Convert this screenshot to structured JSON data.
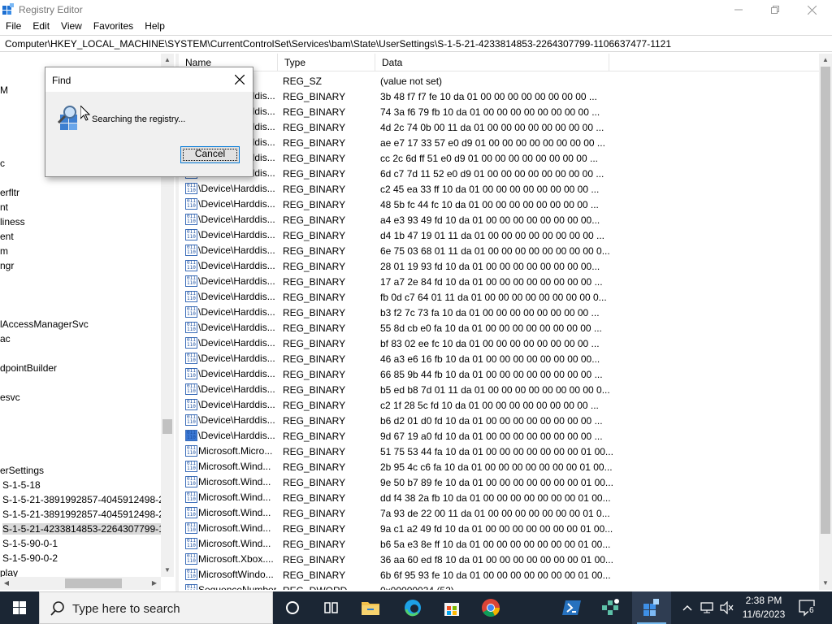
{
  "window": {
    "title": "Registry Editor",
    "menu": [
      "File",
      "Edit",
      "View",
      "Favorites",
      "Help"
    ],
    "address": "Computer\\HKEY_LOCAL_MACHINE\\SYSTEM\\CurrentControlSet\\Services\\bam\\State\\UserSettings\\S-1-5-21-4233814853-2264307799-1106637477-1121"
  },
  "tree": {
    "nodes": [
      {
        "label": "M",
        "selected": false
      },
      {
        "label": "c",
        "selected": false
      },
      {
        "label": "erfltr",
        "selected": false
      },
      {
        "label": "nt",
        "selected": false
      },
      {
        "label": "liness",
        "selected": false
      },
      {
        "label": "ent",
        "selected": false
      },
      {
        "label": "m",
        "selected": false
      },
      {
        "label": "ngr",
        "selected": false
      },
      {
        "label": "lAccessManagerSvc",
        "selected": false
      },
      {
        "label": "ac",
        "selected": false
      },
      {
        "label": "dpointBuilder",
        "selected": false
      },
      {
        "label": "esvc",
        "selected": false
      },
      {
        "label": "erSettings",
        "selected": false
      },
      {
        "label": "S-1-5-18",
        "selected": false
      },
      {
        "label": "S-1-5-21-3891992857-4045912498-27",
        "selected": false
      },
      {
        "label": "S-1-5-21-3891992857-4045912498-27",
        "selected": false
      },
      {
        "label": "S-1-5-21-4233814853-2264307799-11",
        "selected": true
      },
      {
        "label": "S-1-5-90-0-1",
        "selected": false
      },
      {
        "label": "S-1-5-90-0-2",
        "selected": false
      },
      {
        "label": "play",
        "selected": false
      }
    ]
  },
  "list": {
    "columns": [
      "Name",
      "Type",
      "Data"
    ],
    "rows": [
      {
        "name": "",
        "type": "REG_SZ",
        "data": "(value not set)",
        "icon": "string",
        "selected": false
      },
      {
        "name": "\\Device\\Harddis...",
        "type": "REG_BINARY",
        "data": "3b 48 f7 f7 fe 10 da 01 00 00 00 00 00 00 00 00 ...",
        "icon": "binary",
        "selected": false
      },
      {
        "name": "\\Device\\Harddis...",
        "type": "REG_BINARY",
        "data": "74 3a f6 79 fb 10 da 01 00 00 00 00 00 00 00 00 ...",
        "icon": "binary",
        "selected": false
      },
      {
        "name": "\\Device\\Harddis...",
        "type": "REG_BINARY",
        "data": "4d 2c 74 0b 00 11 da 01 00 00 00 00 00 00 00 00 ...",
        "icon": "binary",
        "selected": false
      },
      {
        "name": "\\Device\\Harddis...",
        "type": "REG_BINARY",
        "data": "ae e7 17 33 57 e0 d9 01 00 00 00 00 00 00 00 00 ...",
        "icon": "binary",
        "selected": false
      },
      {
        "name": "\\Device\\Harddis...",
        "type": "REG_BINARY",
        "data": "cc 2c 6d ff 51 e0 d9 01 00 00 00 00 00 00 00 00 ...",
        "icon": "binary",
        "selected": false
      },
      {
        "name": "\\Device\\Harddis...",
        "type": "REG_BINARY",
        "data": "6d c7 7d 11 52 e0 d9 01 00 00 00 00 00 00 00 00 ...",
        "icon": "binary",
        "selected": false
      },
      {
        "name": "\\Device\\Harddis...",
        "type": "REG_BINARY",
        "data": "c2 45 ea 33 ff 10 da 01 00 00 00 00 00 00 00 00 ...",
        "icon": "binary",
        "selected": false
      },
      {
        "name": "\\Device\\Harddis...",
        "type": "REG_BINARY",
        "data": "48 5b fc 44 fc 10 da 01 00 00 00 00 00 00 00 00 ...",
        "icon": "binary",
        "selected": false
      },
      {
        "name": "\\Device\\Harddis...",
        "type": "REG_BINARY",
        "data": "a4 e3 93 49 fd 10 da 01 00 00 00 00 00 00 00 00...",
        "icon": "binary",
        "selected": false
      },
      {
        "name": "\\Device\\Harddis...",
        "type": "REG_BINARY",
        "data": "d4 1b 47 19 01 11 da 01 00 00 00 00 00 00 00 00 ...",
        "icon": "binary",
        "selected": false
      },
      {
        "name": "\\Device\\Harddis...",
        "type": "REG_BINARY",
        "data": "6e 75 03 68 01 11 da 01 00 00 00 00 00 00 00 00 0...",
        "icon": "binary",
        "selected": false
      },
      {
        "name": "\\Device\\Harddis...",
        "type": "REG_BINARY",
        "data": "28 01 19 93 fd 10 da 01 00 00 00 00 00 00 00 00...",
        "icon": "binary",
        "selected": false
      },
      {
        "name": "\\Device\\Harddis...",
        "type": "REG_BINARY",
        "data": "17 a7 2e 84 fd 10 da 01 00 00 00 00 00 00 00 00 ...",
        "icon": "binary",
        "selected": false
      },
      {
        "name": "\\Device\\Harddis...",
        "type": "REG_BINARY",
        "data": "fb 0d c7 64 01 11 da 01 00 00 00 00 00 00 00 00 0...",
        "icon": "binary",
        "selected": false
      },
      {
        "name": "\\Device\\Harddis...",
        "type": "REG_BINARY",
        "data": "b3 f2 7c 73 fa 10 da 01 00 00 00 00 00 00 00 00 ...",
        "icon": "binary",
        "selected": false
      },
      {
        "name": "\\Device\\Harddis...",
        "type": "REG_BINARY",
        "data": "55 8d cb e0 fa 10 da 01 00 00 00 00 00 00 00 00 ...",
        "icon": "binary",
        "selected": false
      },
      {
        "name": "\\Device\\Harddis...",
        "type": "REG_BINARY",
        "data": "bf 83 02 ee fc 10 da 01 00 00 00 00 00 00 00 00 ...",
        "icon": "binary",
        "selected": false
      },
      {
        "name": "\\Device\\Harddis...",
        "type": "REG_BINARY",
        "data": "46 a3 e6 16 fb 10 da 01 00 00 00 00 00 00 00 00...",
        "icon": "binary",
        "selected": false
      },
      {
        "name": "\\Device\\Harddis...",
        "type": "REG_BINARY",
        "data": "66 85 9b 44 fb 10 da 01 00 00 00 00 00 00 00 00 ...",
        "icon": "binary",
        "selected": false
      },
      {
        "name": "\\Device\\Harddis...",
        "type": "REG_BINARY",
        "data": "b5 ed b8 7d 01 11 da 01 00 00 00 00 00 00 00 00 0...",
        "icon": "binary",
        "selected": false
      },
      {
        "name": "\\Device\\Harddis...",
        "type": "REG_BINARY",
        "data": "c2 1f 28 5c fd 10 da 01 00 00 00 00 00 00 00 00 ...",
        "icon": "binary",
        "selected": false
      },
      {
        "name": "\\Device\\Harddis...",
        "type": "REG_BINARY",
        "data": "b6 d2 01 d0 fd 10 da 01 00 00 00 00 00 00 00 00 ...",
        "icon": "binary",
        "selected": false
      },
      {
        "name": "\\Device\\Harddis...",
        "type": "REG_BINARY",
        "data": "9d 67 19 a0 fd 10 da 01 00 00 00 00 00 00 00 00 ...",
        "icon": "binary",
        "selected": true
      },
      {
        "name": "Microsoft.Micro...",
        "type": "REG_BINARY",
        "data": "51 75 53 44 fa 10 da 01 00 00 00 00 00 00 00 01 00...",
        "icon": "binary",
        "selected": false
      },
      {
        "name": "Microsoft.Wind...",
        "type": "REG_BINARY",
        "data": "2b 95 4c c6 fa 10 da 01 00 00 00 00 00 00 00 01 00...",
        "icon": "binary",
        "selected": false
      },
      {
        "name": "Microsoft.Wind...",
        "type": "REG_BINARY",
        "data": "9e 50 b7 89 fe 10 da 01 00 00 00 00 00 00 00 01 00...",
        "icon": "binary",
        "selected": false
      },
      {
        "name": "Microsoft.Wind...",
        "type": "REG_BINARY",
        "data": "dd f4 38 2a fb 10 da 01 00 00 00 00 00 00 00 01 00...",
        "icon": "binary",
        "selected": false
      },
      {
        "name": "Microsoft.Wind...",
        "type": "REG_BINARY",
        "data": "7a 93 de 22 00 11 da 01 00 00 00 00 00 00 00 01 0...",
        "icon": "binary",
        "selected": false
      },
      {
        "name": "Microsoft.Wind...",
        "type": "REG_BINARY",
        "data": "9a c1 a2 49 fd 10 da 01 00 00 00 00 00 00 00 01 00...",
        "icon": "binary",
        "selected": false
      },
      {
        "name": "Microsoft.Wind...",
        "type": "REG_BINARY",
        "data": "b6 5a e3 8e ff 10 da 01 00 00 00 00 00 00 00 01 00...",
        "icon": "binary",
        "selected": false
      },
      {
        "name": "Microsoft.Xbox....",
        "type": "REG_BINARY",
        "data": "36 aa 60 ed f8 10 da 01 00 00 00 00 00 00 00 01 00...",
        "icon": "binary",
        "selected": false
      },
      {
        "name": "MicrosoftWindo...",
        "type": "REG_BINARY",
        "data": "6b 6f 95 93 fe 10 da 01 00 00 00 00 00 00 00 01 00...",
        "icon": "binary",
        "selected": false
      },
      {
        "name": "SequenceNumber",
        "type": "REG_DWORD",
        "data": "0x00000034 (52)",
        "icon": "binary",
        "selected": false
      }
    ]
  },
  "find_dialog": {
    "title": "Find",
    "message": "Searching the registry...",
    "cancel_label": "Cancel"
  },
  "taskbar": {
    "search_placeholder": "Type here to search",
    "time": "2:38 PM",
    "date": "11/6/2023",
    "notification_count": "6",
    "apps": [
      "cortana-icon",
      "task-view-icon",
      "file-explorer-icon",
      "edge-icon",
      "store-icon",
      "chrome-icon",
      "powershell-icon",
      "network-tool-icon",
      "registry-editor-icon"
    ]
  },
  "colors": {
    "taskbar_bg": "#1b2634",
    "accent": "#0078d7",
    "selection": "#d9d9d9"
  }
}
